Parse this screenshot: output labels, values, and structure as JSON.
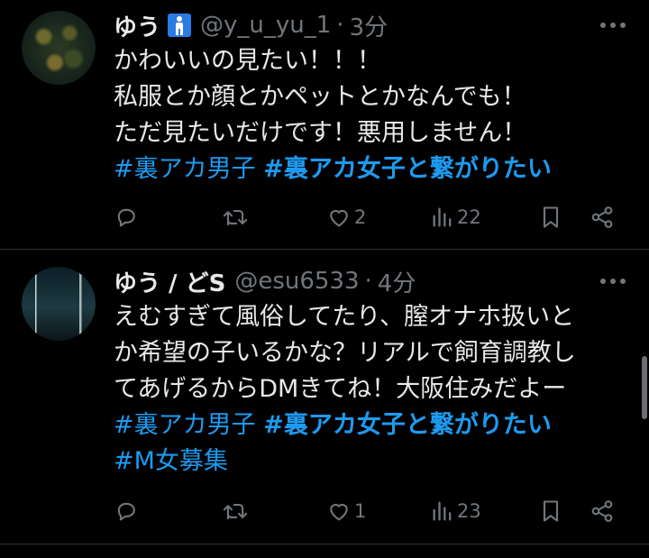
{
  "tweets": [
    {
      "name": "ゆう",
      "handle": "@y_u_yu_1",
      "dot": "·",
      "time": "3分",
      "lines": [
        "かわいいの見たい！！！",
        "私服とか顔とかペットとかなんでも！",
        "ただ見たいだけです！悪用しません！"
      ],
      "hashtags": [
        {
          "text": "#裏アカ男子",
          "bold": false
        },
        {
          "text": "#裏アカ女子と繋がりたい",
          "bold": true
        }
      ],
      "extra_hashtags": [],
      "stats": {
        "replies": "",
        "retweets": "",
        "likes": "2",
        "views": "22"
      }
    },
    {
      "name": "ゆう / どS",
      "handle": "@esu6533",
      "dot": "·",
      "time": "4分",
      "lines": [
        "えむすぎて風俗してたり、膣オナホ扱いと",
        "か希望の子いるかな？リアルで飼育調教し",
        "てあげるからDMきてね！大阪住みだよー"
      ],
      "hashtags": [
        {
          "text": "#裏アカ男子",
          "bold": false
        },
        {
          "text": "#裏アカ女子と繋がりたい",
          "bold": true
        }
      ],
      "extra_hashtags": [
        "#M女募集"
      ],
      "stats": {
        "replies": "",
        "retweets": "",
        "likes": "1",
        "views": "23"
      }
    }
  ],
  "colors": {
    "background": "#000000",
    "text": "#e7e9ea",
    "secondary": "#71767b",
    "hashtag": "#1d9bf0",
    "badge": "#2b7be4"
  },
  "icons": [
    "more-icon",
    "reply-icon",
    "retweet-icon",
    "like-icon",
    "views-icon",
    "bookmark-icon",
    "share-icon"
  ]
}
